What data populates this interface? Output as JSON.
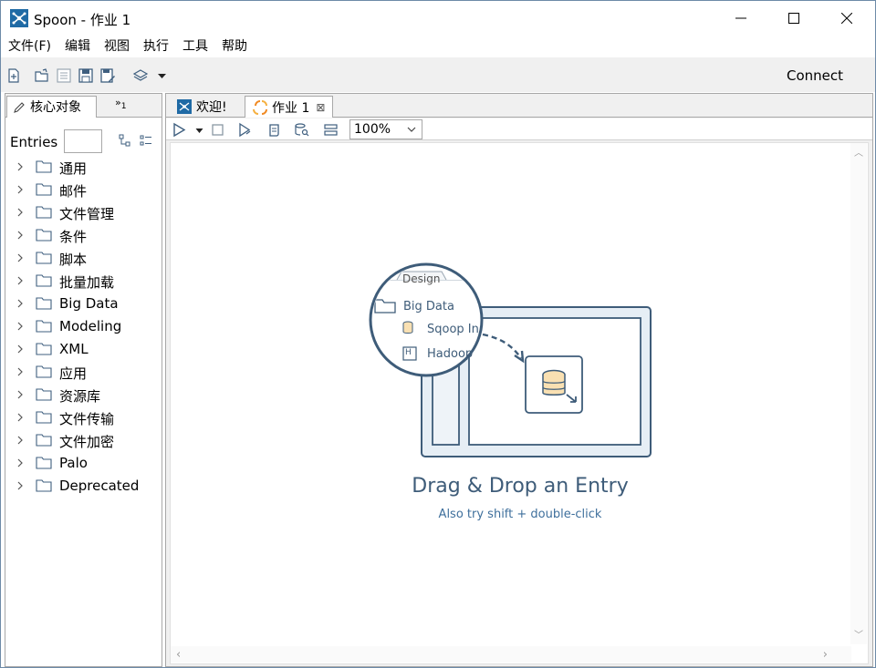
{
  "window": {
    "title": "Spoon - 作业 1",
    "app_icon": "spoon-icon"
  },
  "menu": {
    "items": [
      "文件(F)",
      "编辑",
      "视图",
      "执行",
      "工具",
      "帮助"
    ]
  },
  "toolbar": {
    "connect_label": "Connect",
    "icons": [
      "new-file-icon",
      "open-folder-icon",
      "explore-icon",
      "save-icon",
      "save-as-icon",
      "layers-icon",
      "dropdown-icon"
    ]
  },
  "left_panel": {
    "tab_label": "核心对象",
    "more_tabs_label": "»",
    "more_tabs_count": "1",
    "entries_label": "Entries",
    "entries_input_value": "",
    "tree_items": [
      "通用",
      "邮件",
      "文件管理",
      "条件",
      "脚本",
      "批量加载",
      "Big Data",
      "Modeling",
      "XML",
      "应用",
      "资源库",
      "文件传输",
      "文件加密",
      "Palo",
      "Deprecated"
    ]
  },
  "right_panel": {
    "tabs": [
      {
        "label": "欢迎!",
        "icon": "spoon-icon",
        "active": false
      },
      {
        "label": "作业 1",
        "icon": "job-icon",
        "active": true
      }
    ],
    "zoom_value": "100%",
    "canvas": {
      "hint_title": "Drag & Drop an Entry",
      "hint_subtitle": "Also try shift + double-click",
      "illustration": {
        "tab_label": "Design",
        "folder_label": "Big Data",
        "item1": "Sqoop In",
        "item2": "Hadoop"
      }
    }
  },
  "colors": {
    "accent": "#1f6aa5",
    "illustration_stroke": "#3e5c79",
    "hint_sub": "#3e6f9c",
    "toolbar_bg": "#f0f0f0"
  }
}
